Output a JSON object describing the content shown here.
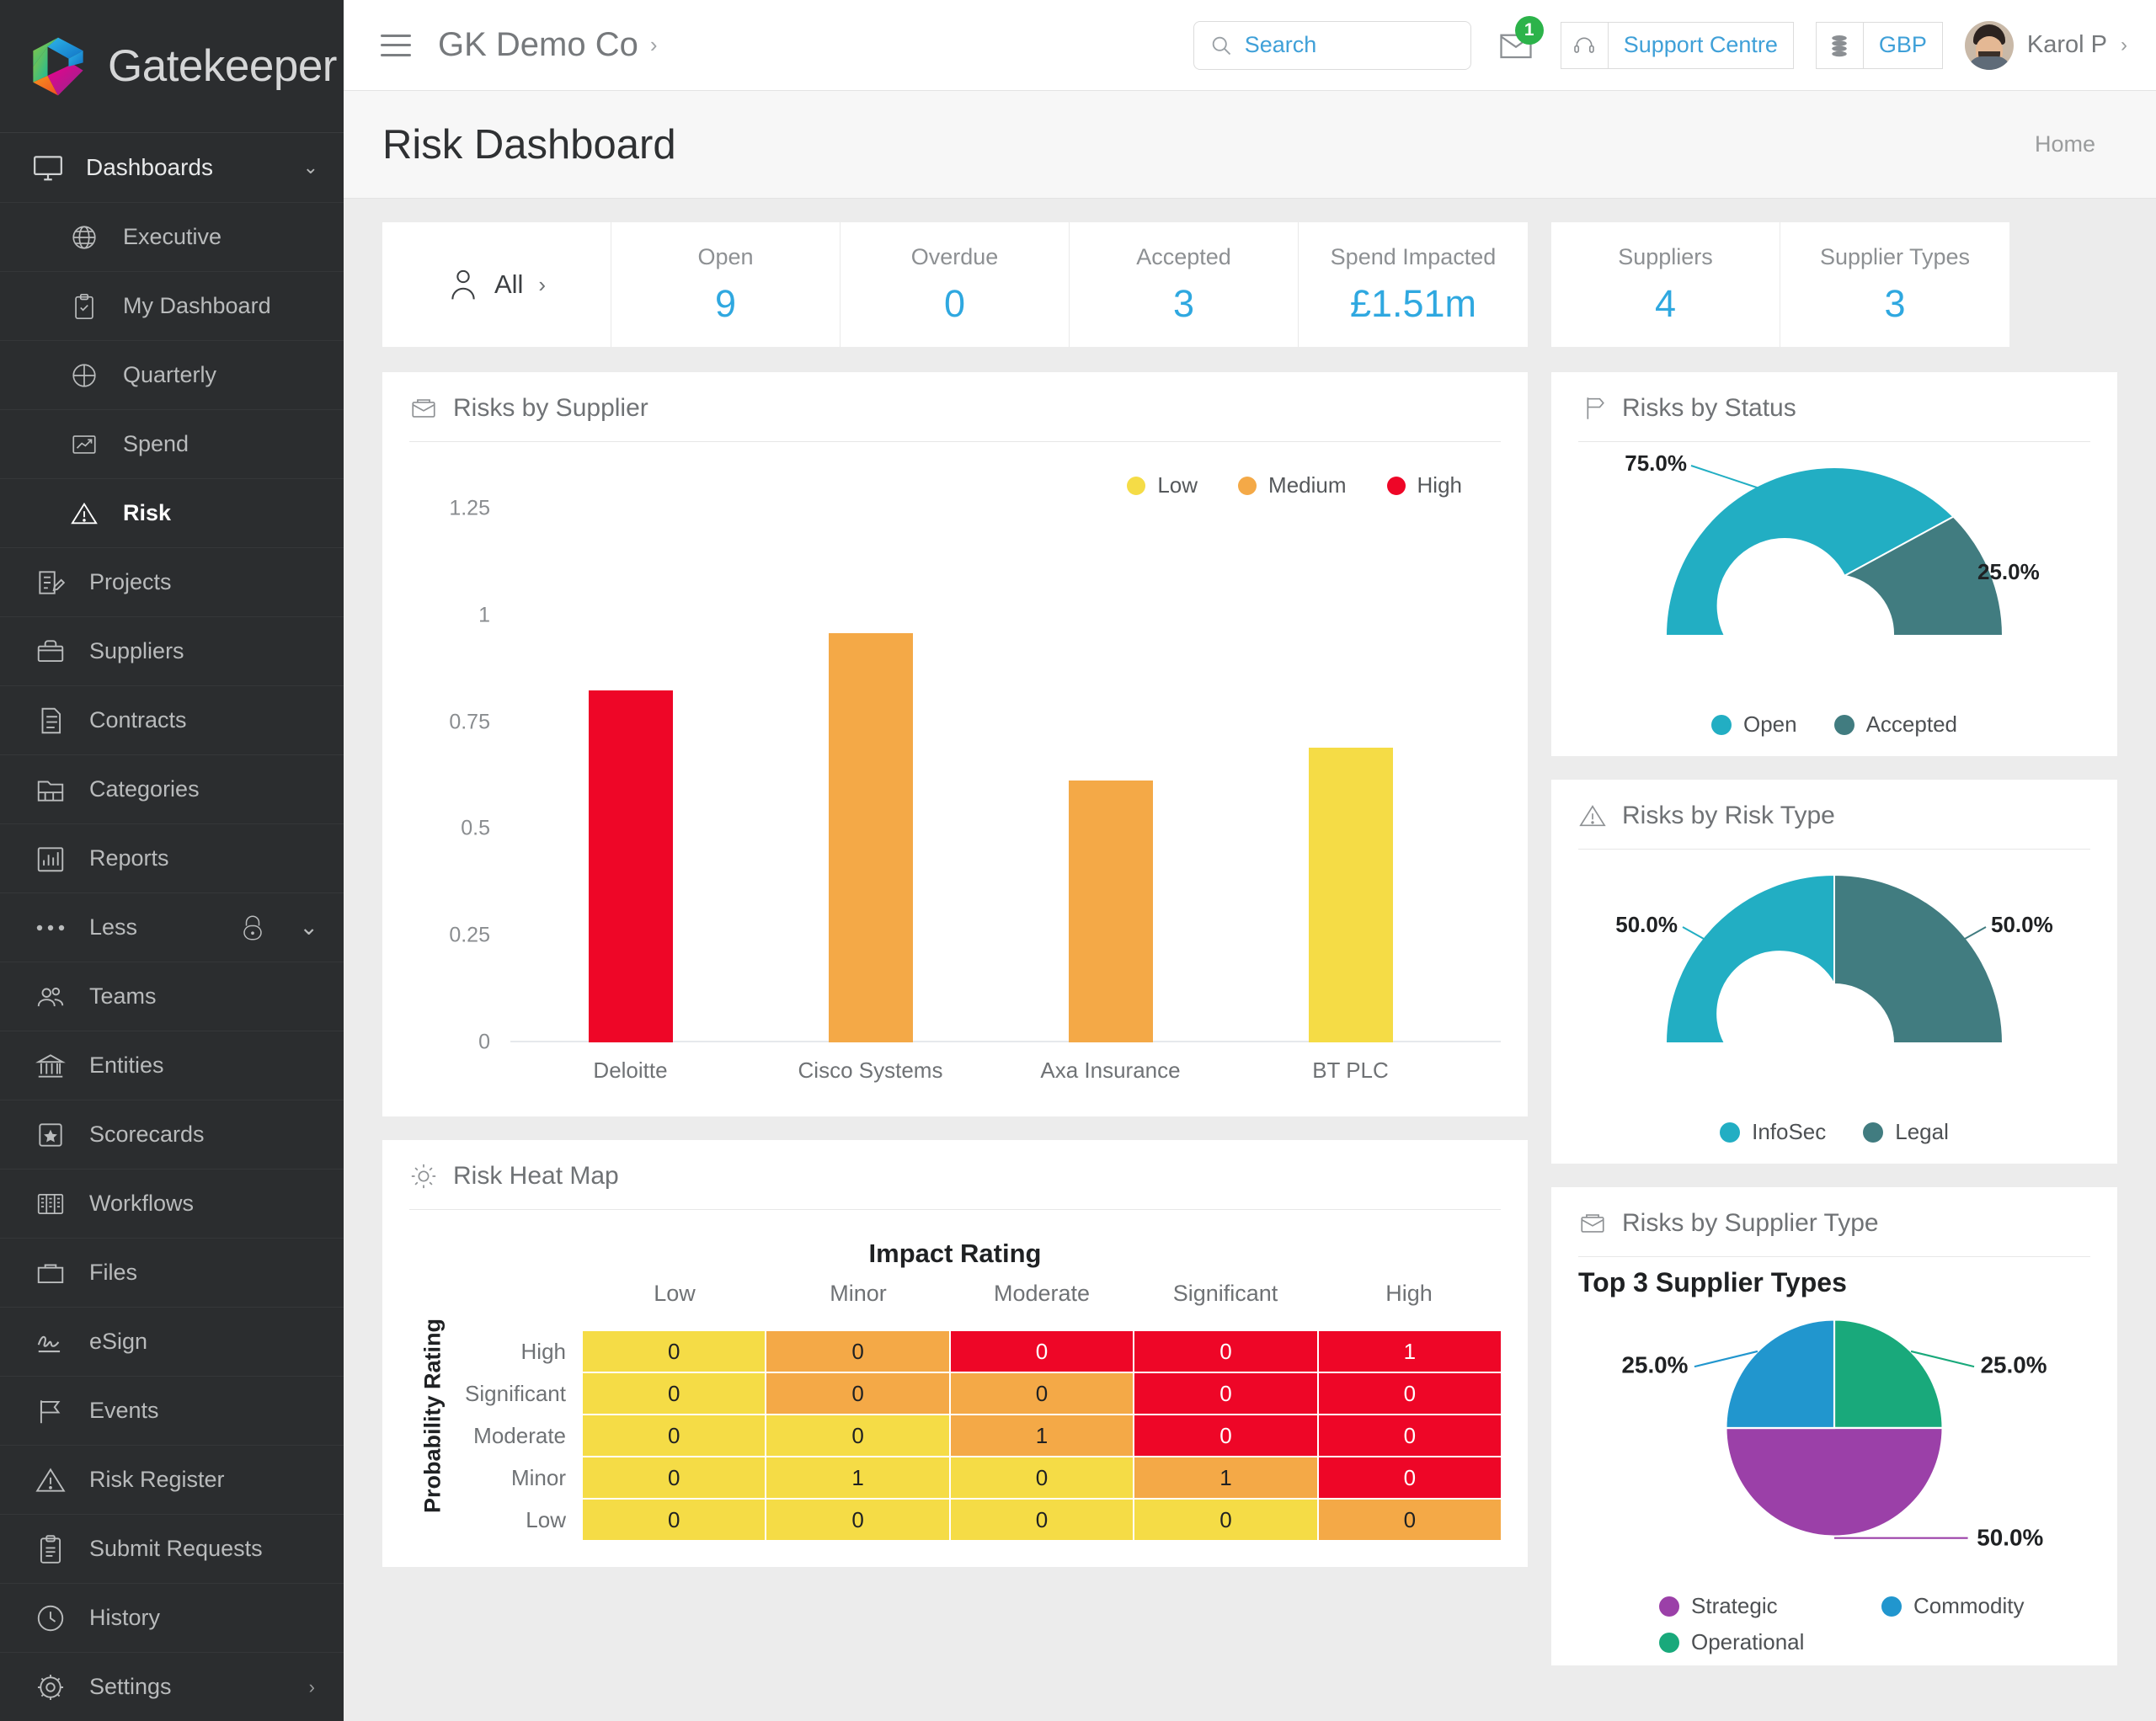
{
  "brand": {
    "name": "Gatekeeper"
  },
  "sidebar": {
    "group": {
      "label": "Dashboards",
      "icon": "monitor-icon",
      "chevron": "⌄"
    },
    "sub_items": [
      {
        "label": "Executive",
        "icon": "globe-icon"
      },
      {
        "label": "My Dashboard",
        "icon": "clipboard-check-icon"
      },
      {
        "label": "Quarterly",
        "icon": "pie-slice-icon"
      },
      {
        "label": "Spend",
        "icon": "trend-chart-icon"
      },
      {
        "label": "Risk",
        "icon": "warning-triangle-icon",
        "active": true
      }
    ],
    "items": [
      {
        "label": "Projects",
        "icon": "project-edit-icon"
      },
      {
        "label": "Suppliers",
        "icon": "briefcase-icon"
      },
      {
        "label": "Contracts",
        "icon": "document-icon"
      },
      {
        "label": "Categories",
        "icon": "folder-tabs-icon"
      },
      {
        "label": "Reports",
        "icon": "bar-chart-icon"
      }
    ],
    "less": {
      "label": "Less",
      "icon": "ellipsis-icon",
      "lock_icon": "lock-icon",
      "chevron": "⌄"
    },
    "more_items": [
      {
        "label": "Teams",
        "icon": "people-icon"
      },
      {
        "label": "Entities",
        "icon": "bank-icon"
      },
      {
        "label": "Scorecards",
        "icon": "star-box-icon"
      },
      {
        "label": "Workflows",
        "icon": "kanban-icon"
      },
      {
        "label": "Files",
        "icon": "folder-icon"
      },
      {
        "label": "eSign",
        "icon": "signature-icon"
      },
      {
        "label": "Events",
        "icon": "flag-icon"
      },
      {
        "label": "Risk Register",
        "icon": "warning-triangle-icon"
      },
      {
        "label": "Submit Requests",
        "icon": "clipboard-lines-icon"
      },
      {
        "label": "History",
        "icon": "clock-icon"
      },
      {
        "label": "Settings",
        "icon": "gear-icon",
        "chevron": "›"
      }
    ]
  },
  "topbar": {
    "menu_icon": "hamburger-icon",
    "breadcrumb": "GK Demo Co",
    "breadcrumb_chevron": "›",
    "search": {
      "placeholder": "Search",
      "value": "",
      "icon": "search-icon"
    },
    "mail": {
      "icon": "envelope-icon",
      "badge": "1"
    },
    "support": {
      "label": "Support Centre",
      "icon": "headset-icon"
    },
    "currency": {
      "label": "GBP",
      "icon": "coins-icon"
    },
    "user": {
      "name": "Karol P",
      "chevron": "›",
      "avatar": "user-avatar"
    }
  },
  "page": {
    "title": "Risk Dashboard",
    "home_link": "Home"
  },
  "kpis": {
    "filter": {
      "label": "All",
      "icon": "person-icon",
      "chevron": "›"
    },
    "group_a": [
      {
        "label": "Open",
        "value": "9"
      },
      {
        "label": "Overdue",
        "value": "0"
      },
      {
        "label": "Accepted",
        "value": "3"
      },
      {
        "label": "Spend Impacted",
        "value": "£1.51m"
      }
    ],
    "group_b": [
      {
        "label": "Suppliers",
        "value": "4"
      },
      {
        "label": "Supplier Types",
        "value": "3"
      }
    ]
  },
  "cards": {
    "risks_by_supplier": {
      "title": "Risks by Supplier",
      "icon": "briefcase-icon"
    },
    "risks_by_status": {
      "title": "Risks by Status",
      "icon": "signpost-icon"
    },
    "risks_by_risk_type": {
      "title": "Risks by Risk Type",
      "icon": "warning-triangle-icon"
    },
    "risk_heat_map": {
      "title": "Risk Heat Map",
      "icon": "sun-icon"
    },
    "risks_by_supplier_type": {
      "title": "Risks by Supplier Type",
      "icon": "briefcase-icon",
      "subtitle": "Top 3 Supplier Types"
    }
  },
  "colors": {
    "low": "#F5DC46",
    "medium": "#F4A947",
    "high": "#EE0627",
    "teal": "#22AEC3",
    "dark_teal": "#417C80",
    "purple": "#9B40A8",
    "blue": "#2196CE",
    "green": "#19A97B",
    "accent_link": "#3FA0D8",
    "kpi_value": "#2FA8E0"
  },
  "chart_data": [
    {
      "type": "bar",
      "title": "Risks by Supplier",
      "categories": [
        "Deloitte",
        "Cisco Systems",
        "Axa Insurance",
        "BT PLC"
      ],
      "values": [
        0.86,
        1,
        0.64,
        0.72
      ],
      "bar_colors": [
        "#EE0627",
        "#F4A947",
        "#F4A947",
        "#F5DC46"
      ],
      "legend": [
        {
          "label": "Low",
          "color": "#F5DC46"
        },
        {
          "label": "Medium",
          "color": "#F4A947"
        },
        {
          "label": "High",
          "color": "#EE0627"
        }
      ],
      "legend_position": "top-right",
      "xlabel": "",
      "ylabel": "",
      "ylim": [
        0,
        1.25
      ],
      "yticks": [
        "0",
        "0.25",
        "0.5",
        "0.75",
        "1",
        "1.25"
      ],
      "ytick_values": [
        0,
        0.25,
        0.5,
        0.75,
        1,
        1.25
      ],
      "grid": false
    },
    {
      "type": "pie",
      "variant": "half-donut",
      "title": "Risks by Status",
      "labels": [
        "Open",
        "Accepted"
      ],
      "values": [
        75.0,
        25.0
      ],
      "value_labels": [
        "75.0%",
        "25.0%"
      ],
      "colors": [
        "#22AEC3",
        "#417C80"
      ],
      "legend_position": "bottom"
    },
    {
      "type": "pie",
      "variant": "half-donut",
      "title": "Risks by Risk Type",
      "labels": [
        "InfoSec",
        "Legal"
      ],
      "values": [
        50.0,
        50.0
      ],
      "value_labels": [
        "50.0%",
        "50.0%"
      ],
      "colors": [
        "#22AEC3",
        "#417C80"
      ],
      "legend_position": "bottom"
    },
    {
      "type": "heatmap",
      "title": "Risk Heat Map",
      "xlabel": "Impact Rating",
      "ylabel": "Probability Rating",
      "columns": [
        "Low",
        "Minor",
        "Moderate",
        "Significant",
        "High"
      ],
      "rows": [
        "High",
        "Significant",
        "Moderate",
        "Minor",
        "Low"
      ],
      "values": [
        [
          0,
          0,
          0,
          0,
          1
        ],
        [
          0,
          0,
          0,
          0,
          0
        ],
        [
          0,
          0,
          1,
          0,
          0
        ],
        [
          0,
          1,
          0,
          1,
          0
        ],
        [
          0,
          0,
          0,
          0,
          0
        ]
      ],
      "cell_colors": [
        [
          "#F5DC46",
          "#F4A947",
          "#EE0627",
          "#EE0627",
          "#EE0627"
        ],
        [
          "#F5DC46",
          "#F4A947",
          "#F4A947",
          "#EE0627",
          "#EE0627"
        ],
        [
          "#F5DC46",
          "#F5DC46",
          "#F4A947",
          "#EE0627",
          "#EE0627"
        ],
        [
          "#F5DC46",
          "#F5DC46",
          "#F5DC46",
          "#F4A947",
          "#EE0627"
        ],
        [
          "#F5DC46",
          "#F5DC46",
          "#F5DC46",
          "#F5DC46",
          "#F4A947"
        ]
      ]
    },
    {
      "type": "pie",
      "variant": "full-pie",
      "title": "Risks by Supplier Type",
      "subtitle": "Top 3 Supplier Types",
      "labels": [
        "Strategic",
        "Commodity",
        "Operational"
      ],
      "values": [
        50.0,
        25.0,
        25.0
      ],
      "value_labels": [
        "50.0%",
        "25.0%",
        "25.0%"
      ],
      "colors": [
        "#9B40A8",
        "#2196CE",
        "#19A97B"
      ],
      "legend_position": "bottom"
    }
  ]
}
